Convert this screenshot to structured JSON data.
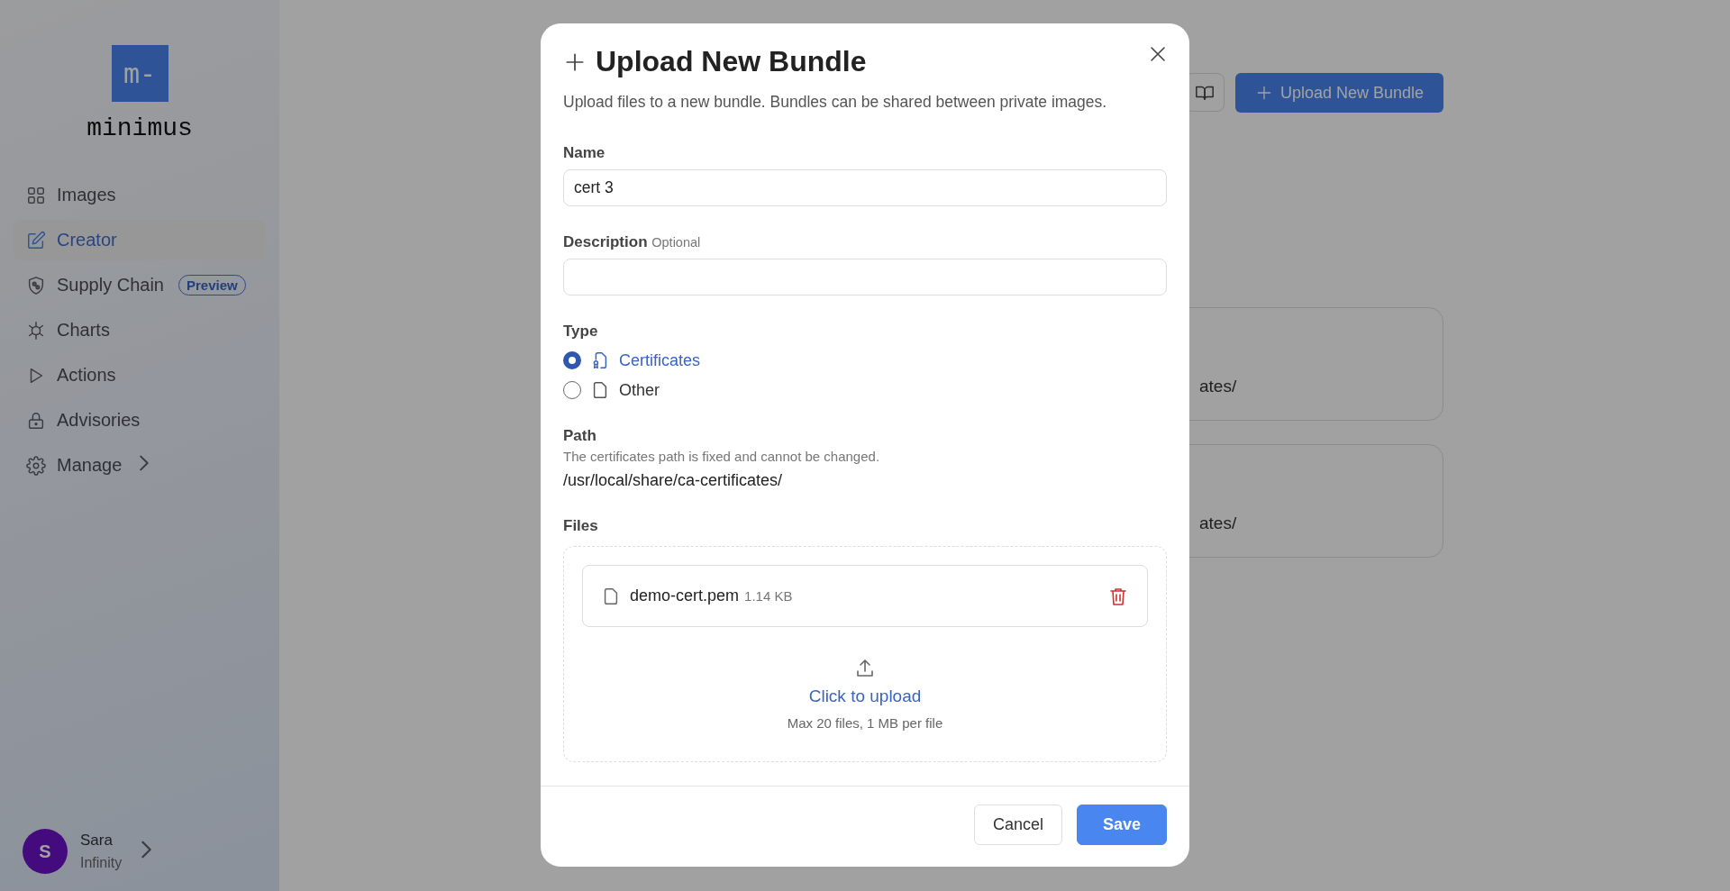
{
  "sidebar": {
    "logo": {
      "mark": "m-",
      "name": "minimus"
    },
    "items": [
      {
        "label": "Images",
        "selected": false
      },
      {
        "label": "Creator",
        "selected": true
      },
      {
        "label": "Supply Chain",
        "badge": "Preview",
        "selected": false
      },
      {
        "label": "Charts",
        "selected": false
      },
      {
        "label": "Actions",
        "selected": false
      },
      {
        "label": "Advisories",
        "selected": false
      },
      {
        "label": "Manage",
        "expandable": true,
        "selected": false
      }
    ],
    "user": {
      "initial": "S",
      "name": "Sara",
      "org": "Infinity"
    }
  },
  "toolbar": {
    "upload_button": "Upload New Bundle"
  },
  "bundle_cards": [
    {
      "path_tail": "ates/"
    },
    {
      "path_tail": "ates/"
    }
  ],
  "dialog": {
    "title": "Upload New Bundle",
    "subtitle": "Upload files to a new bundle. Bundles can be shared between private images.",
    "fields": [
      {
        "label": "Name",
        "value": "cert 3"
      },
      {
        "label": "Description",
        "note": "Optional"
      }
    ],
    "type": {
      "label": "Type",
      "options": [
        {
          "label": "Certificates",
          "selected": true
        },
        {
          "label": "Other",
          "selected": false
        }
      ]
    },
    "path": {
      "label": "Path",
      "hint": "The certificates path is fixed and cannot be changed.",
      "value": "/usr/local/share/ca-certificates/"
    },
    "files": {
      "label": "Files",
      "items": [
        {
          "name": "demo-cert.pem",
          "size": "1.14 KB"
        }
      ],
      "upload_link": "Click to upload",
      "limits": "Max 20 files, 1 MB per file"
    },
    "buttons": [
      {
        "label": "Cancel",
        "kind": "secondary"
      },
      {
        "label": "Save",
        "kind": "primary"
      }
    ]
  }
}
